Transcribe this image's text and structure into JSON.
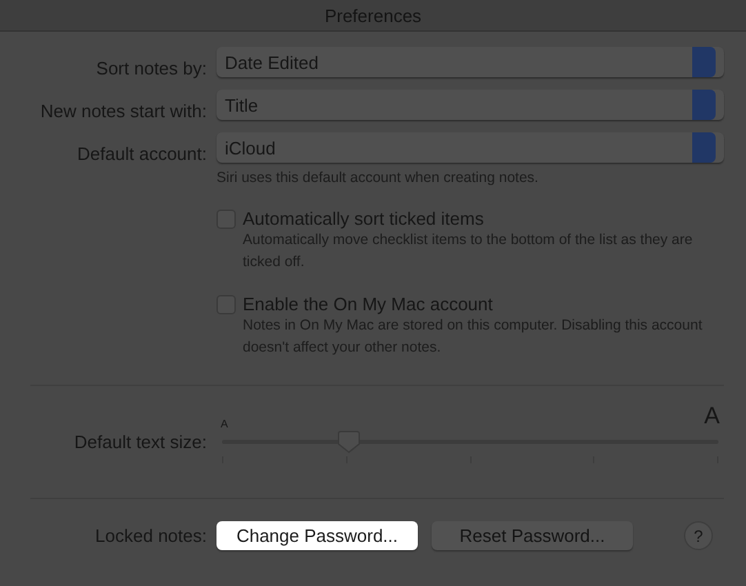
{
  "window": {
    "title": "Preferences"
  },
  "popups": [
    {
      "label": "Sort notes by:",
      "value": "Date Edited"
    },
    {
      "label": "New notes start with:",
      "value": "Title"
    },
    {
      "label": "Default account:",
      "value": "iCloud"
    }
  ],
  "account_hint": "Siri uses this default account when creating notes.",
  "checkboxes": [
    {
      "label": "Automatically sort ticked items",
      "checked": false,
      "description": "Automatically move checklist items to the bottom of the list as they are ticked off."
    },
    {
      "label": "Enable the On My Mac account",
      "checked": false,
      "description": "Notes in On My Mac are stored on this computer. Disabling this account doesn't affect your other notes."
    }
  ],
  "text_size": {
    "label": "Default text size:",
    "small_mark": "A",
    "large_mark": "A",
    "level": 0.255
  },
  "locked_notes": {
    "label": "Locked notes:",
    "buttons": [
      {
        "label": "Change Password...",
        "highlighted": true
      },
      {
        "label": "Reset Password...",
        "highlighted": false
      }
    ],
    "help": "?"
  }
}
